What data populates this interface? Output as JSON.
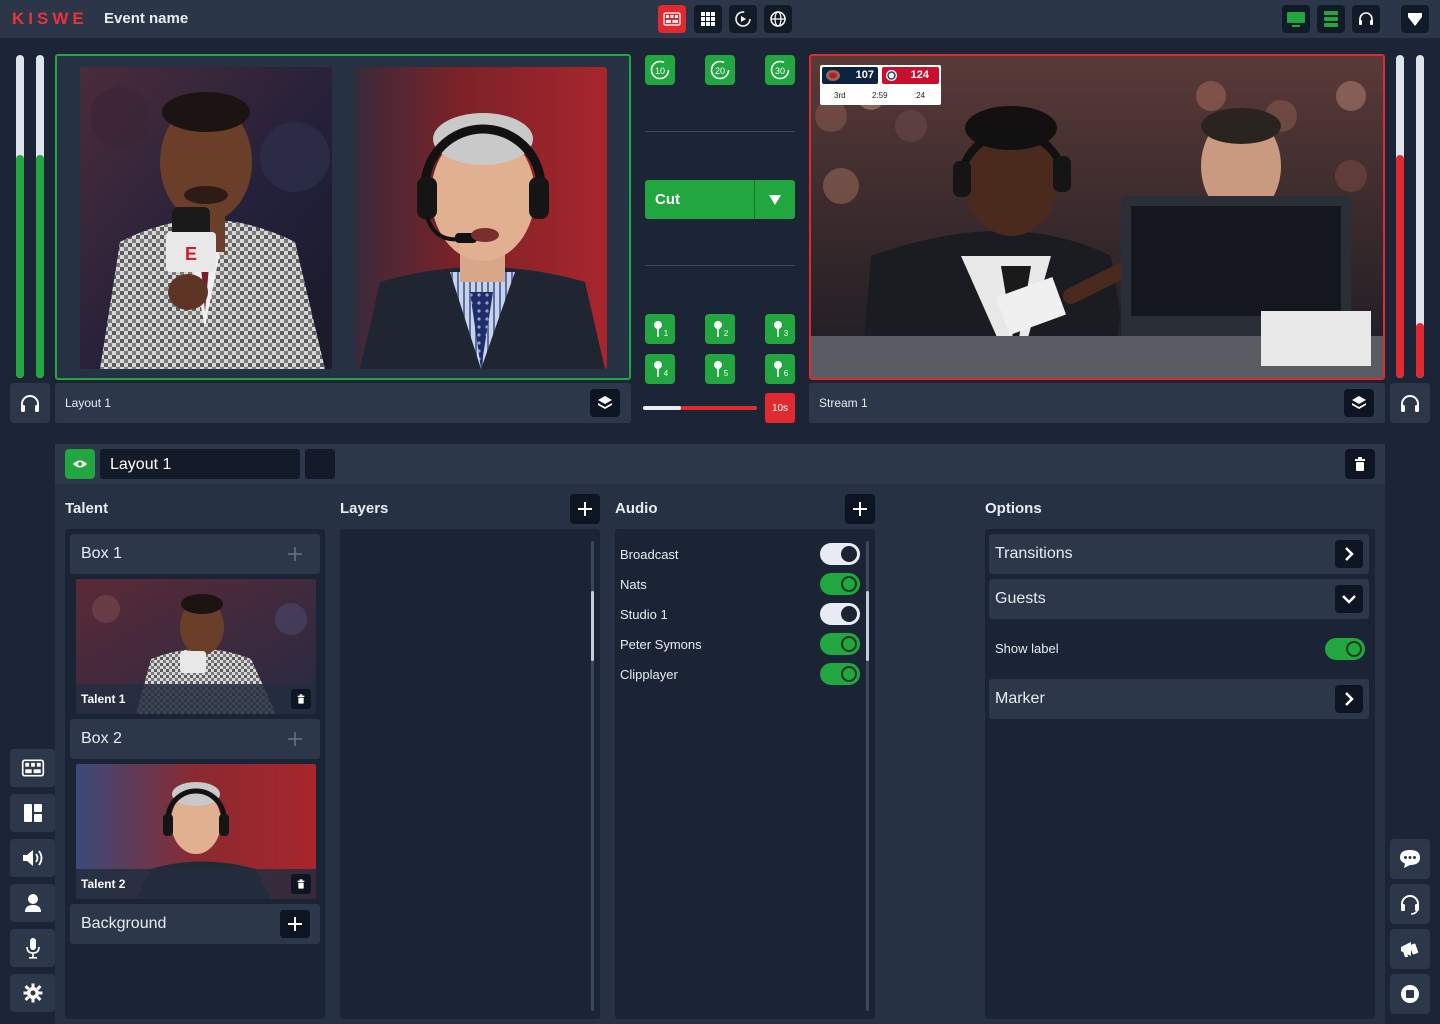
{
  "app": {
    "logo": "KISWE",
    "event_name": "Event name"
  },
  "topbar": {
    "left_buttons": [
      "multiview-icon",
      "grid-icon",
      "replay-icon",
      "globe-icon"
    ],
    "right_buttons": [
      "monitor-icon",
      "server-icon",
      "headset-icon",
      "shield-icon"
    ]
  },
  "preview": {
    "label": "Layout 1"
  },
  "program": {
    "label": "Stream 1",
    "scoreboard": {
      "away_score": "107",
      "home_score": "124",
      "period": "3rd",
      "clock": "2:59",
      "shot_clock": ":24"
    }
  },
  "controls": {
    "replay_buttons": [
      "10",
      "20",
      "30"
    ],
    "cut_label": "Cut",
    "markers": [
      "1",
      "2",
      "3",
      "4",
      "5",
      "6"
    ],
    "transition_progress": 0.33,
    "countdown": "10s"
  },
  "meters": {
    "left_a": 0.69,
    "left_b": 0.69,
    "right_a": 0.69,
    "right_b": 0.17
  },
  "editor": {
    "layout_name": "Layout 1",
    "talent": {
      "title": "Talent",
      "boxes": [
        {
          "label": "Box 1",
          "talent": "Talent 1"
        },
        {
          "label": "Box 2",
          "talent": "Talent 2"
        }
      ],
      "background": "Background"
    },
    "layers": {
      "title": "Layers"
    },
    "audio": {
      "title": "Audio",
      "items": [
        {
          "label": "Broadcast",
          "on": false
        },
        {
          "label": "Nats",
          "on": true
        },
        {
          "label": "Studio 1",
          "on": false
        },
        {
          "label": "Peter Symons",
          "on": true
        },
        {
          "label": "Clipplayer",
          "on": true
        }
      ]
    },
    "options": {
      "title": "Options",
      "transitions": "Transitions",
      "guests": "Guests",
      "show_label": "Show label",
      "show_label_on": true,
      "marker": "Marker"
    }
  },
  "sidebar_left": [
    "multiview-icon",
    "layout-icon",
    "speaker-icon",
    "person-icon",
    "microphone-icon",
    "settings-icon"
  ],
  "sidebar_right": [
    "chat-icon",
    "headset-icon",
    "megaphone-icon",
    "record-icon"
  ],
  "colors": {
    "accent_green": "#21a640",
    "accent_red": "#e02a2f",
    "brand_red": "#e8323c",
    "panel": "#2c3749",
    "background": "#1c2535"
  }
}
